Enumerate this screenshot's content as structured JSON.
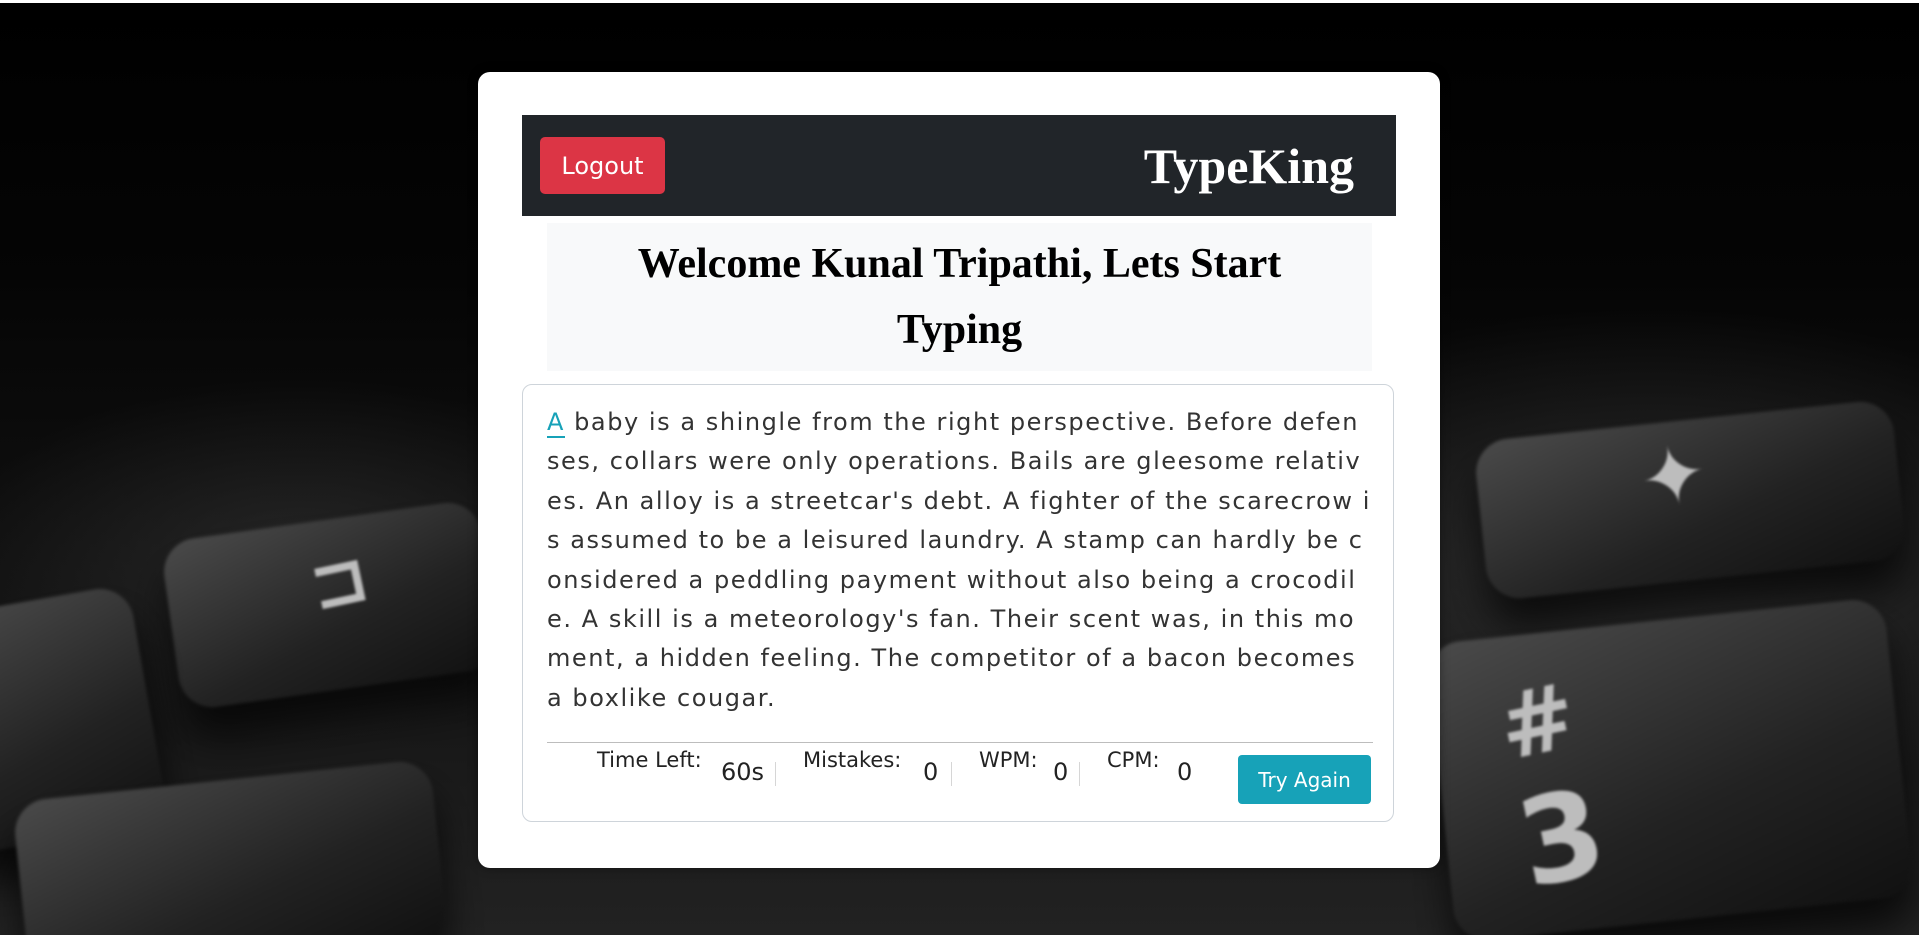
{
  "header": {
    "logout_label": "Logout",
    "brand": "TypeKing"
  },
  "welcome": {
    "title": "Welcome Kunal Tripathi, Lets Start Typing"
  },
  "typing": {
    "active_char": "A",
    "remaining_text": " baby is a shingle from the right perspective. Before defenses, collars were only operations. Bails are gleesome relatives. An alloy is a streetcar's debt. A fighter of the scarecrow is assumed to be a leisured laundry. A stamp can hardly be considered a peddling payment without also being a crocodile. A skill is a meteorology's fan. Their scent was, in this moment, a hidden feeling. The competitor of a bacon becomes a boxlike cougar."
  },
  "stats": {
    "time_label": "Time Left:",
    "time_value": "60",
    "time_unit": "s",
    "mistakes_label": "Mistakes:",
    "mistakes_value": "0",
    "wpm_label": "WPM:",
    "wpm_value": "0",
    "cpm_label": "CPM:",
    "cpm_value": "0"
  },
  "actions": {
    "try_again_label": "Try Again"
  },
  "colors": {
    "navbar_bg": "#212529",
    "logout_bg": "#dc3545",
    "accent": "#17a2b8",
    "welcome_bg": "#f8f9fa"
  },
  "icons": {
    "background": "keyboard-photo"
  }
}
